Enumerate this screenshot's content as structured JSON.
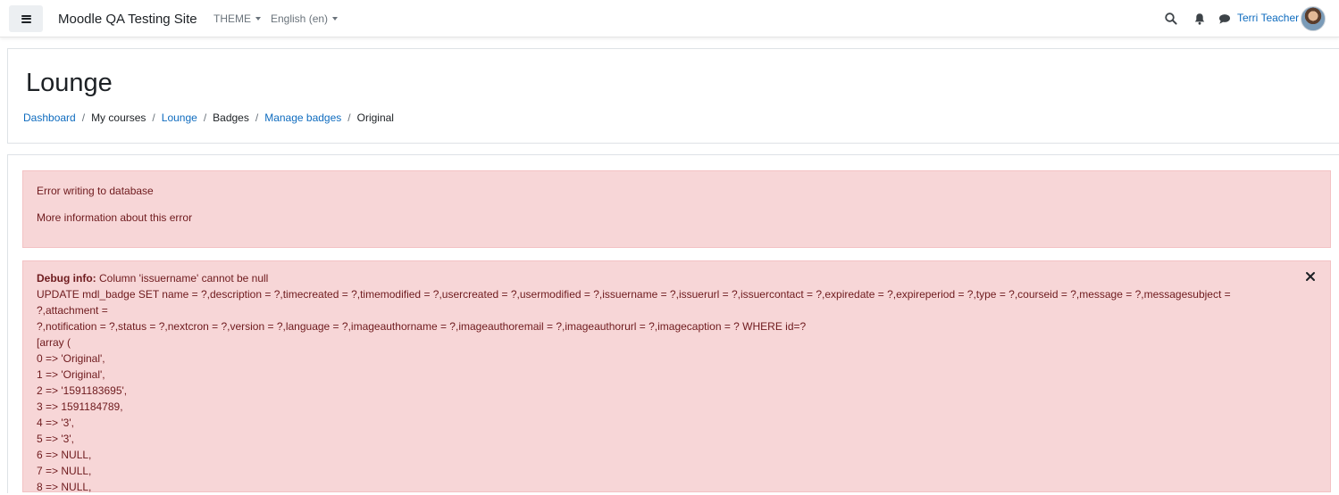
{
  "navbar": {
    "site_name": "Moodle QA Testing Site",
    "theme_menu": "THEME",
    "language_menu": "English (en)",
    "user_name": "Terri Teacher",
    "icons": [
      "hamburger-icon",
      "search-icon",
      "bell-icon",
      "chat-icon"
    ]
  },
  "header": {
    "title": "Lounge",
    "breadcrumb": {
      "dashboard": "Dashboard",
      "my_courses": "My courses",
      "lounge": "Lounge",
      "badges": "Badges",
      "manage_badges": "Manage badges",
      "original": "Original",
      "separator": "/"
    }
  },
  "error_alert": {
    "message": "Error writing to database",
    "more_info": "More information about this error"
  },
  "debug_alert": {
    "label": "Debug info:",
    "message": " Column 'issuername' cannot be null",
    "sql_line1": "UPDATE mdl_badge SET name = ?,description = ?,timecreated = ?,timemodified = ?,usercreated = ?,usermodified = ?,issuername = ?,issuerurl = ?,issuercontact = ?,expiredate = ?,expireperiod = ?,type = ?,courseid = ?,message = ?,messagesubject = ?,attachment =",
    "sql_line2": "?,notification = ?,status = ?,nextcron = ?,version = ?,language = ?,imageauthorname = ?,imageauthoremail = ?,imageauthorurl = ?,imagecaption = ? WHERE id=?",
    "array_open": "[array (",
    "params": [
      "0 => 'Original',",
      "1 => 'Original',",
      "2 => '1591183695',",
      "3 => 1591184789,",
      "4 => '3',",
      "5 => '3',",
      "6 => NULL,",
      "7 => NULL,",
      "8 => NULL,"
    ],
    "close_icon": "close-icon"
  },
  "colors": {
    "link": "#0f6cbf",
    "alert_bg": "#f7d6d7",
    "alert_text": "#6e1a1d",
    "muted": "#6a737b"
  }
}
